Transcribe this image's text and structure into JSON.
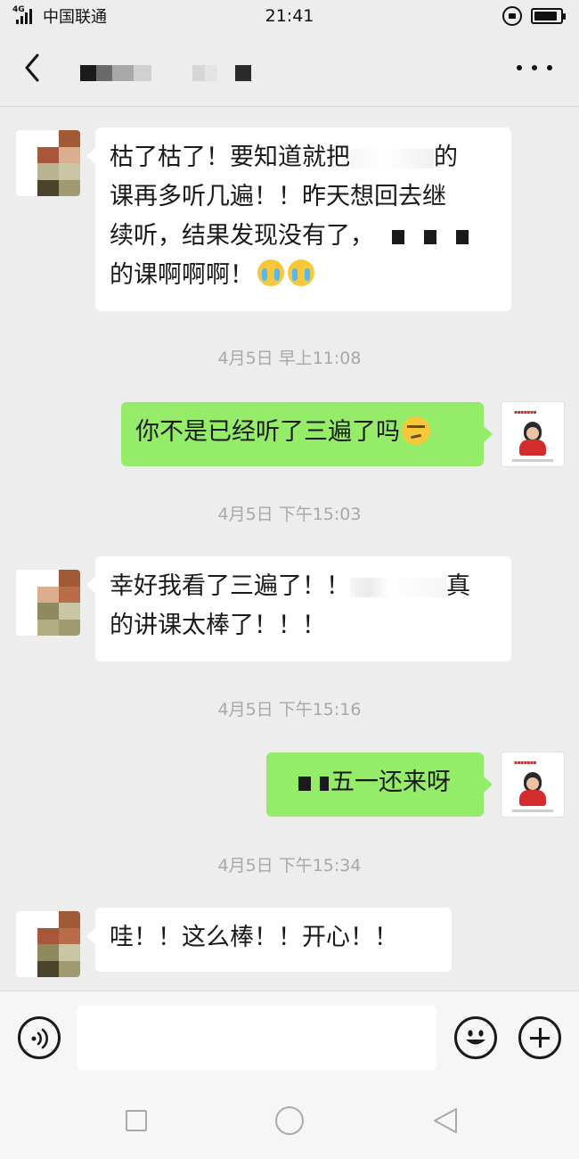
{
  "status_bar": {
    "network_type": "4G",
    "carrier": "中国联通",
    "time": "21:41",
    "battery_level": 0.9
  },
  "header": {
    "back_icon": "chevron-left-icon",
    "more_icon": "more-icon"
  },
  "messages": [
    {
      "side": "left",
      "line1_before": "枯了枯了！要知道就把",
      "line1_after": "的",
      "line2": "课再多听几遍！！昨天想回去继",
      "line3": "续听，结果发现没有了，",
      "line4": "的课啊啊啊！",
      "emoji": "crying-face"
    },
    {
      "side": "right",
      "text": "你不是已经听了三遍了吗",
      "emoji": "smirk-face"
    },
    {
      "side": "left",
      "line1_before": "幸好我看了三遍了！！",
      "line1_after": "真",
      "line2": "的讲课太棒了！！！"
    },
    {
      "side": "right",
      "text": "五一还来呀"
    },
    {
      "side": "left",
      "text": "哇！！这么棒！！开心！！"
    }
  ],
  "timestamps": [
    "4月5日 早上11:08",
    "4月5日 下午15:03",
    "4月5日 下午15:16",
    "4月5日 下午15:34"
  ],
  "input_bar": {
    "voice_icon": "voice-icon",
    "emoji_icon": "emoji-icon",
    "plus_icon": "plus-icon",
    "placeholder": ""
  },
  "colors": {
    "background": "#ededed",
    "self_bubble": "#95ec69",
    "other_bubble": "#ffffff",
    "timestamp": "#a8a8a8"
  }
}
